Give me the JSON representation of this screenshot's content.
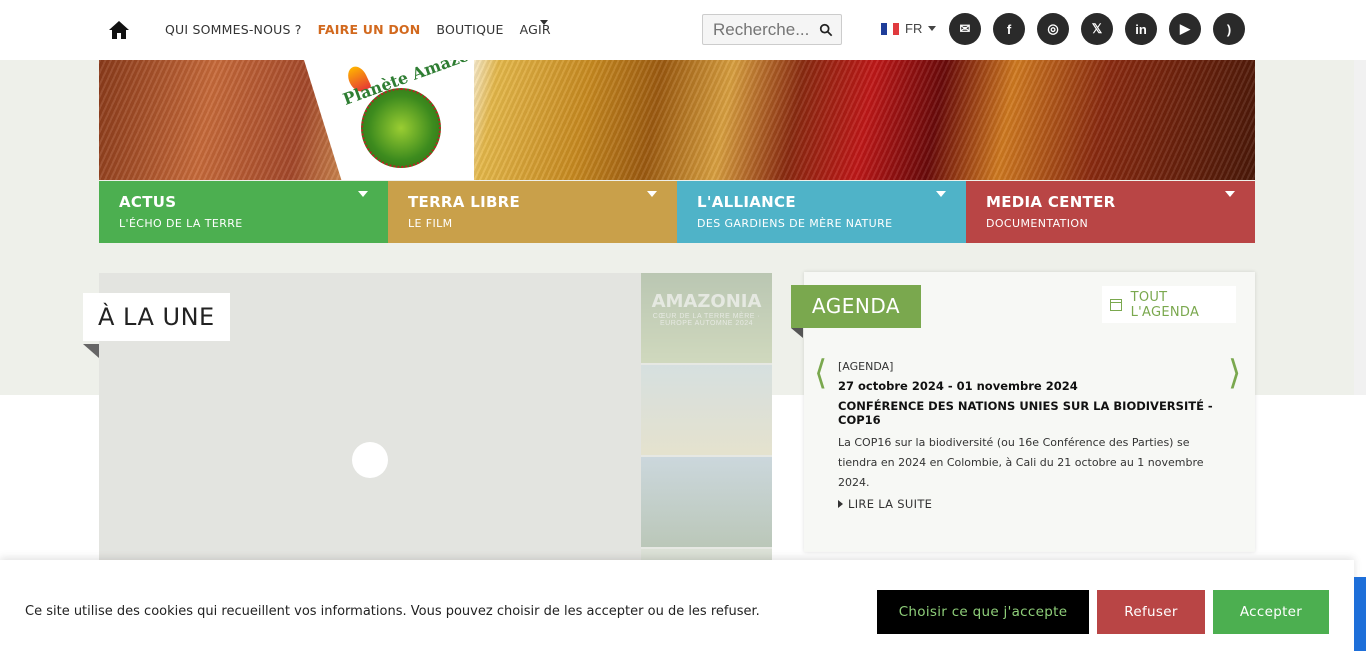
{
  "topnav": {
    "items": [
      {
        "label": "QUI SOMMES-NOUS ?"
      },
      {
        "label": "FAIRE UN DON"
      },
      {
        "label": "BOUTIQUE"
      },
      {
        "label": "AGIR"
      }
    ],
    "accent_color": "#d2691e"
  },
  "search": {
    "placeholder": "Recherche..."
  },
  "lang": {
    "selected": "FR"
  },
  "socials": [
    {
      "icon": "email-icon",
      "glyph": "✉"
    },
    {
      "icon": "facebook-icon",
      "glyph": "f"
    },
    {
      "icon": "instagram-icon",
      "glyph": "◎"
    },
    {
      "icon": "x-icon",
      "glyph": "𝕏"
    },
    {
      "icon": "linkedin-icon",
      "glyph": "in"
    },
    {
      "icon": "youtube-icon",
      "glyph": "▶"
    },
    {
      "icon": "rss-icon",
      "glyph": ")"
    }
  ],
  "logo": {
    "text": "Planète Amazone"
  },
  "categories": [
    {
      "title": "ACTUS",
      "subtitle": "L'ÉCHO DE LA TERRE",
      "color": "#4caf50"
    },
    {
      "title": "TERRA LIBRE",
      "subtitle": "LE FILM",
      "color": "#c9a04a"
    },
    {
      "title": "L'ALLIANCE",
      "subtitle": "DES GARDIENS DE MÈRE NATURE",
      "color": "#4fb3c8"
    },
    {
      "title": "MEDIA CENTER",
      "subtitle": "DOCUMENTATION",
      "color": "#b94545"
    }
  ],
  "une": {
    "label": "À LA UNE",
    "thumb_title": "AMAZONIA",
    "thumb_sub": "CŒUR DE LA TERRE MÈRE · EUROPE AUTOMNE 2024"
  },
  "agenda": {
    "label": "AGENDA",
    "all_label": "TOUT L'AGENDA",
    "prev_glyph": "⟨",
    "next_glyph": "⟩",
    "accent_color": "#7aa84e",
    "item": {
      "category": "[AGENDA]",
      "date": "27 octobre 2024 - 01 novembre 2024",
      "title": "CONFÉRENCE DES NATIONS UNIES SUR LA BIODIVERSITÉ - COP16",
      "description": "La COP16 sur la biodiversité (ou 16e Conférence des Parties) se tiendra en 2024 en Colombie, à Cali du 21 octobre au 1 novembre 2024.",
      "more": "LIRE LA SUITE"
    }
  },
  "cookie": {
    "text": "Ce site utilise des cookies qui recueillent vos informations. Vous pouvez choisir de les accepter ou de les refuser.",
    "choose_label": "Choisir ce que j'accepte",
    "refuse_label": "Refuser",
    "accept_label": "Accepter"
  }
}
